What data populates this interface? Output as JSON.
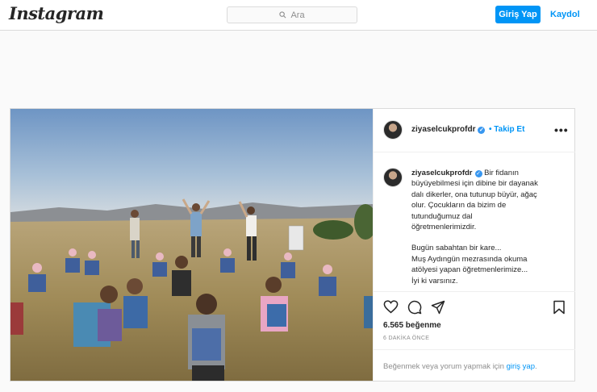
{
  "header": {
    "logo": "Instagram",
    "search_placeholder": "Ara",
    "login_label": "Giriş Yap",
    "signup_label": "Kaydol"
  },
  "post": {
    "username": "ziyaselcukprofdr",
    "verified": true,
    "follow_label": "Takip Et",
    "more_icon": "more-options-icon",
    "caption": {
      "username": "ziyaselcukprofdr",
      "lines": [
        "Bir fidanın",
        "büyüyebilmesi için dibine bir dayanak",
        "dalı dikerler, ona tutunup büyür, ağaç",
        "olur. Çocukların da bizim de",
        "tutunduğumuz dal",
        "öğretmenlerimizdir.",
        "",
        "Bugün sabahtan bir kare...",
        "Muş Aydıngün mezrasında okuma",
        "atölyesi yapan öğretmenlerimize...",
        "İyi ki varsınız."
      ]
    },
    "likes": "6.565 beğenme",
    "timestamp": "6 DAKİKA ÖNCE",
    "comment_prompt": "Beğenmek veya yorum yapmak için",
    "comment_link": "giriş yap",
    "comment_suffix": "."
  },
  "colors": {
    "accent": "#0095f6",
    "border": "#dbdbdb",
    "background": "#fafafa"
  }
}
